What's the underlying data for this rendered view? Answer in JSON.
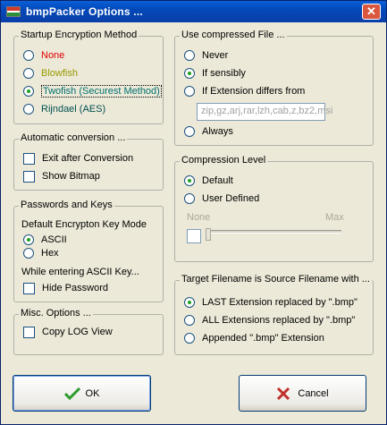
{
  "window": {
    "title": "bmpPacker Options ...",
    "close_glyph": "✕"
  },
  "startup": {
    "legend": "Startup Encryption Method",
    "options": [
      {
        "label": "None",
        "color": "#e00000",
        "selected": false
      },
      {
        "label": "Blowfish",
        "color": "#999900",
        "selected": false
      },
      {
        "label": "Twofish (Securest Method)",
        "color": "#007070",
        "selected": true
      },
      {
        "label": "Rijndael (AES)",
        "color": "#005050",
        "selected": false
      }
    ]
  },
  "automatic": {
    "legend": "Automatic conversion ...",
    "exit_label": "Exit after Conversion",
    "show_label": "Show Bitmap"
  },
  "passwords": {
    "legend": "Passwords and Keys",
    "mode_label": "Default Encrypton Key Mode",
    "ascii_label": "ASCII",
    "hex_label": "Hex",
    "entering_label": "While entering ASCII Key...",
    "hide_label": "Hide Password"
  },
  "misc": {
    "legend": "Misc. Options ...",
    "copy_label": "Copy LOG View"
  },
  "compressed": {
    "legend": "Use compressed File ...",
    "never": "Never",
    "sensibly": "If sensibly",
    "ext_differs": "If Extension differs from",
    "ext_value": "zip,gz,arj,rar,lzh,cab,z,bz2,msi",
    "always": "Always"
  },
  "compression": {
    "legend": "Compression Level",
    "default": "Default",
    "user": "User Defined",
    "min_label": "None",
    "max_label": "Max"
  },
  "target": {
    "legend": "Target Filename is Source Filename with ...",
    "last": "LAST Extension replaced by \".bmp\"",
    "all": "ALL Extensions replaced by \".bmp\"",
    "appended": "Appended \".bmp\" Extension"
  },
  "buttons": {
    "ok": "OK",
    "cancel": "Cancel"
  },
  "colors": {
    "title_bar": "#0348b8",
    "dialog_bg": "#ece9d8",
    "ok_icon": "#2e9a2e",
    "cancel_icon": "#c0302a"
  }
}
